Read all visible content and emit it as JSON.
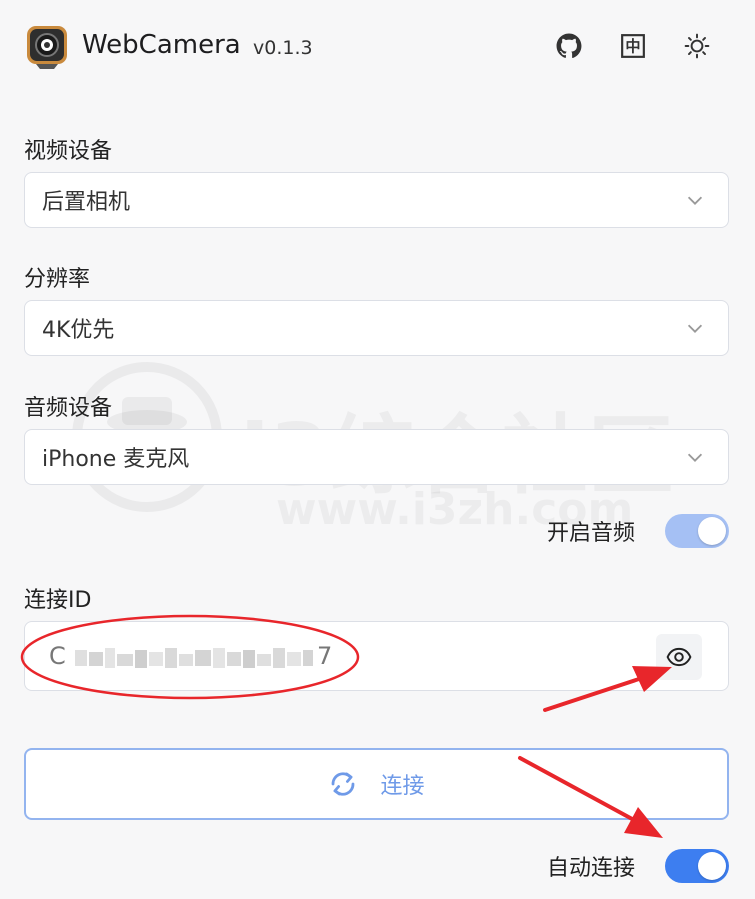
{
  "header": {
    "app_title": "WebCamera",
    "version": "v0.1.3",
    "lang_icon_text": "中",
    "icons": [
      "github-icon",
      "language-icon",
      "sun-icon"
    ]
  },
  "video_device": {
    "label": "视频设备",
    "value": "后置相机"
  },
  "resolution": {
    "label": "分辨率",
    "value": "4K优先"
  },
  "audio_device": {
    "label": "音频设备",
    "value": "iPhone 麦克风"
  },
  "audio_toggle": {
    "label": "开启音频",
    "on": true
  },
  "connection_id": {
    "label": "连接ID",
    "visible_start": "C",
    "visible_end": "7"
  },
  "connect_button": {
    "label": "连接"
  },
  "auto_connect": {
    "label": "自动连接",
    "on": true
  },
  "watermark": {
    "title": "i3综合社区",
    "url": "www.i3zh.com"
  },
  "colors": {
    "accent": "#3d7ef0",
    "accent_light": "#a5c0f4",
    "annotation": "#e8262b"
  }
}
